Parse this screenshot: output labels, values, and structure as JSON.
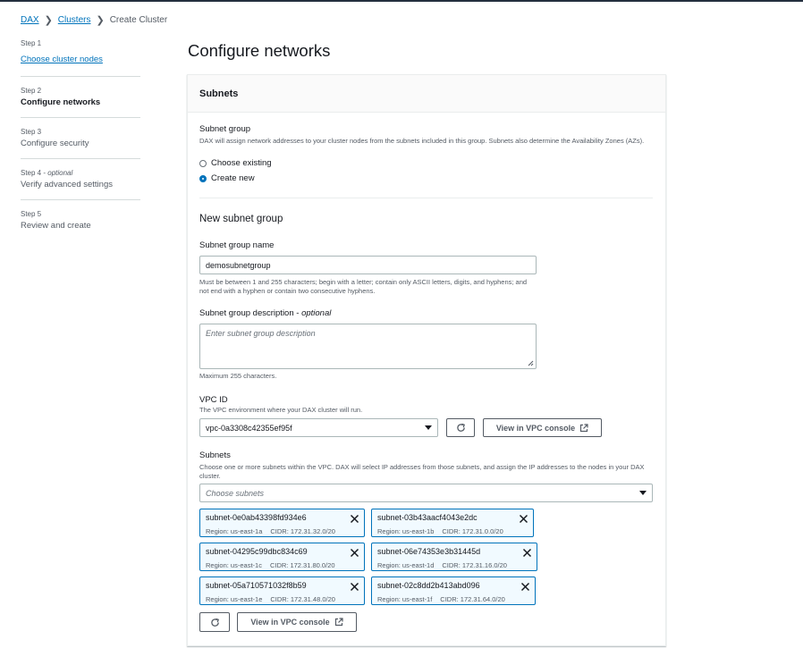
{
  "breadcrumbs": {
    "items": [
      "DAX",
      "Clusters"
    ],
    "current": "Create Cluster"
  },
  "steps": [
    {
      "num": "Step 1",
      "optional": "",
      "label": "Choose cluster nodes"
    },
    {
      "num": "Step 2",
      "optional": "",
      "label": "Configure networks"
    },
    {
      "num": "Step 3",
      "optional": "",
      "label": "Configure security"
    },
    {
      "num": "Step 4 - ",
      "optional": "optional",
      "label": "Verify advanced settings"
    },
    {
      "num": "Step 5",
      "optional": "",
      "label": "Review and create"
    }
  ],
  "page_title": "Configure networks",
  "panel": {
    "title": "Subnets",
    "subnet_group": {
      "label": "Subnet group",
      "description": "DAX will assign network addresses to your cluster nodes from the subnets included in this group. Subnets also determine the Availability Zones (AZs).",
      "options": [
        "Choose existing",
        "Create new"
      ],
      "selected": "Create new"
    },
    "new_subnet_group_title": "New subnet group",
    "name_field": {
      "label": "Subnet group name",
      "value": "demosubnetgroup",
      "hint": "Must be between 1 and 255 characters; begin with a letter; contain only ASCII letters, digits, and hyphens; and not end with a hyphen or contain two consecutive hyphens."
    },
    "description_field": {
      "label": "Subnet group description - ",
      "label_optional": "optional",
      "placeholder": "Enter subnet group description",
      "hint": "Maximum 255 characters."
    },
    "vpc": {
      "label": "VPC ID",
      "description": "The VPC environment where your DAX cluster will run.",
      "value": "vpc-0a3308c42355ef95f",
      "console_button": "View in VPC console"
    },
    "subnets": {
      "label": "Subnets",
      "description": "Choose one or more subnets within the VPC. DAX will select IP addresses from those subnets, and assign the IP addresses to the nodes in your DAX cluster.",
      "placeholder": "Choose subnets",
      "tokens": [
        {
          "name": "subnet-0e0ab43398fd934e6",
          "region": "Region: us-east-1a",
          "cidr": "CIDR: 172.31.32.0/20"
        },
        {
          "name": "subnet-03b43aacf4043e2dc",
          "region": "Region: us-east-1b",
          "cidr": "CIDR: 172.31.0.0/20"
        },
        {
          "name": "subnet-04295c99dbc834c69",
          "region": "Region: us-east-1c",
          "cidr": "CIDR: 172.31.80.0/20"
        },
        {
          "name": "subnet-06e74353e3b31445d",
          "region": "Region: us-east-1d",
          "cidr": "CIDR: 172.31.16.0/20"
        },
        {
          "name": "subnet-05a710571032f8b59",
          "region": "Region: us-east-1e",
          "cidr": "CIDR: 172.31.48.0/20"
        },
        {
          "name": "subnet-02c8dd2b413abd096",
          "region": "Region: us-east-1f",
          "cidr": "CIDR: 172.31.64.0/20"
        }
      ],
      "console_button": "View in VPC console"
    }
  },
  "icons": {
    "chevron": "chevron-right-icon",
    "caret": "caret-down-icon",
    "refresh": "refresh-icon",
    "external": "external-link-icon",
    "close": "close-icon"
  },
  "colors": {
    "link": "#0073bb",
    "token_bg": "#f1faff",
    "token_border": "#0073bb",
    "header_bar": "#232f3e"
  }
}
